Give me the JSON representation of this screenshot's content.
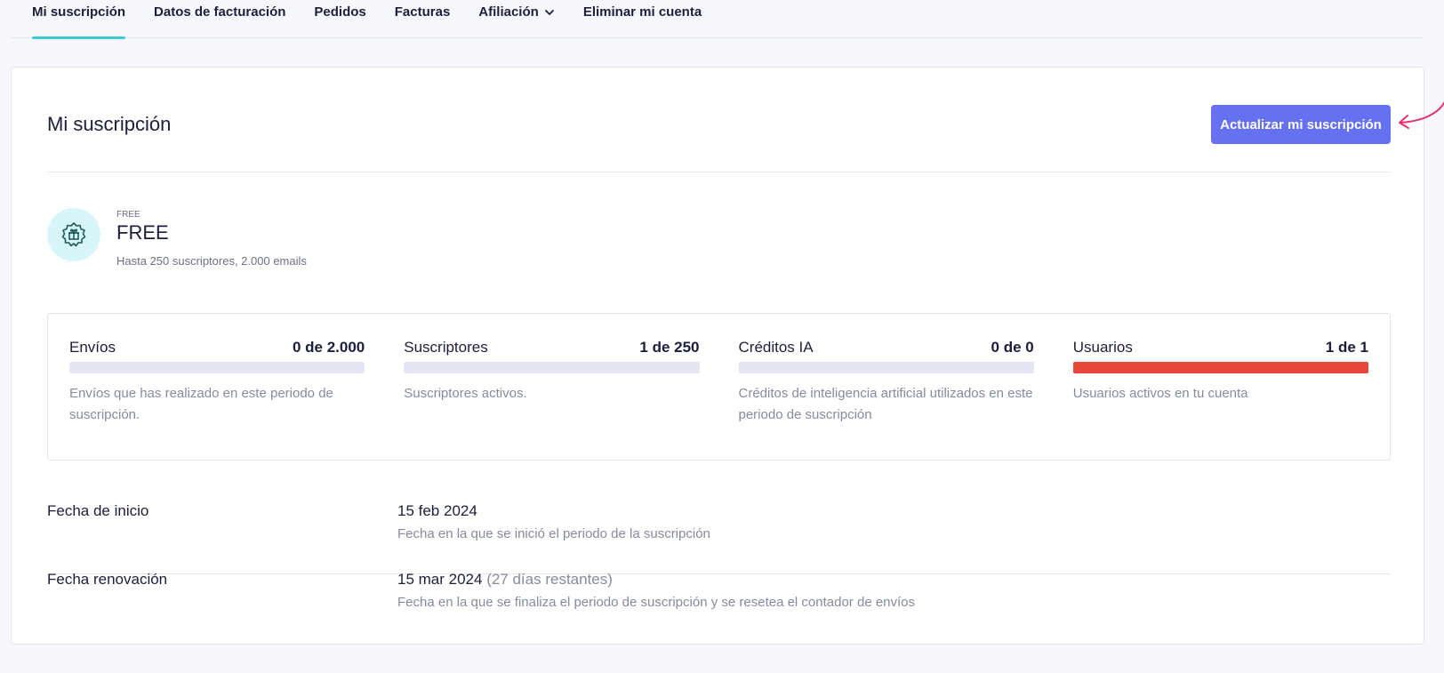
{
  "tabs": [
    {
      "label": "Mi suscripción",
      "active": true
    },
    {
      "label": "Datos de facturación"
    },
    {
      "label": "Pedidos"
    },
    {
      "label": "Facturas"
    },
    {
      "label": "Afiliación",
      "dropdown": true
    },
    {
      "label": "Eliminar mi cuenta"
    }
  ],
  "header": {
    "title": "Mi suscripción",
    "upgrade_button": "Actualizar mi suscripción"
  },
  "plan": {
    "icon": "gift-badge-icon",
    "tag": "FREE",
    "name": "FREE",
    "description": "Hasta 250 suscriptores, 2.000 emails"
  },
  "usage": [
    {
      "label": "Envíos",
      "value": "0 de 2.000",
      "fraction": 0,
      "note": "Envíos que has realizado en este periodo de suscripción."
    },
    {
      "label": "Suscriptores",
      "value": "1 de 250",
      "fraction": 0,
      "note": "Suscriptores activos."
    },
    {
      "label": "Créditos IA",
      "value": "0 de 0",
      "fraction": 0,
      "note": "Créditos de inteligencia artificial utilizados en este periodo de suscripción"
    },
    {
      "label": "Usuarios",
      "value": "1 de 1",
      "fraction": 1,
      "note": "Usuarios activos en tu cuenta"
    }
  ],
  "dates": {
    "start": {
      "label": "Fecha de inicio",
      "value": "15 feb 2024",
      "note": "Fecha en la que se inició el periodo de la suscripción"
    },
    "renewal": {
      "label": "Fecha renovación",
      "value": "15 mar 2024",
      "remaining": "(27 días restantes)",
      "note": "Fecha en la que se finaliza el periodo de suscripción y se resetea el contador de envíos"
    }
  },
  "colors": {
    "accent_button": "#6571f0",
    "active_tab": "#3fc9d8",
    "bar_full": "#e5473a",
    "annotation_arrow": "#e8336a"
  }
}
